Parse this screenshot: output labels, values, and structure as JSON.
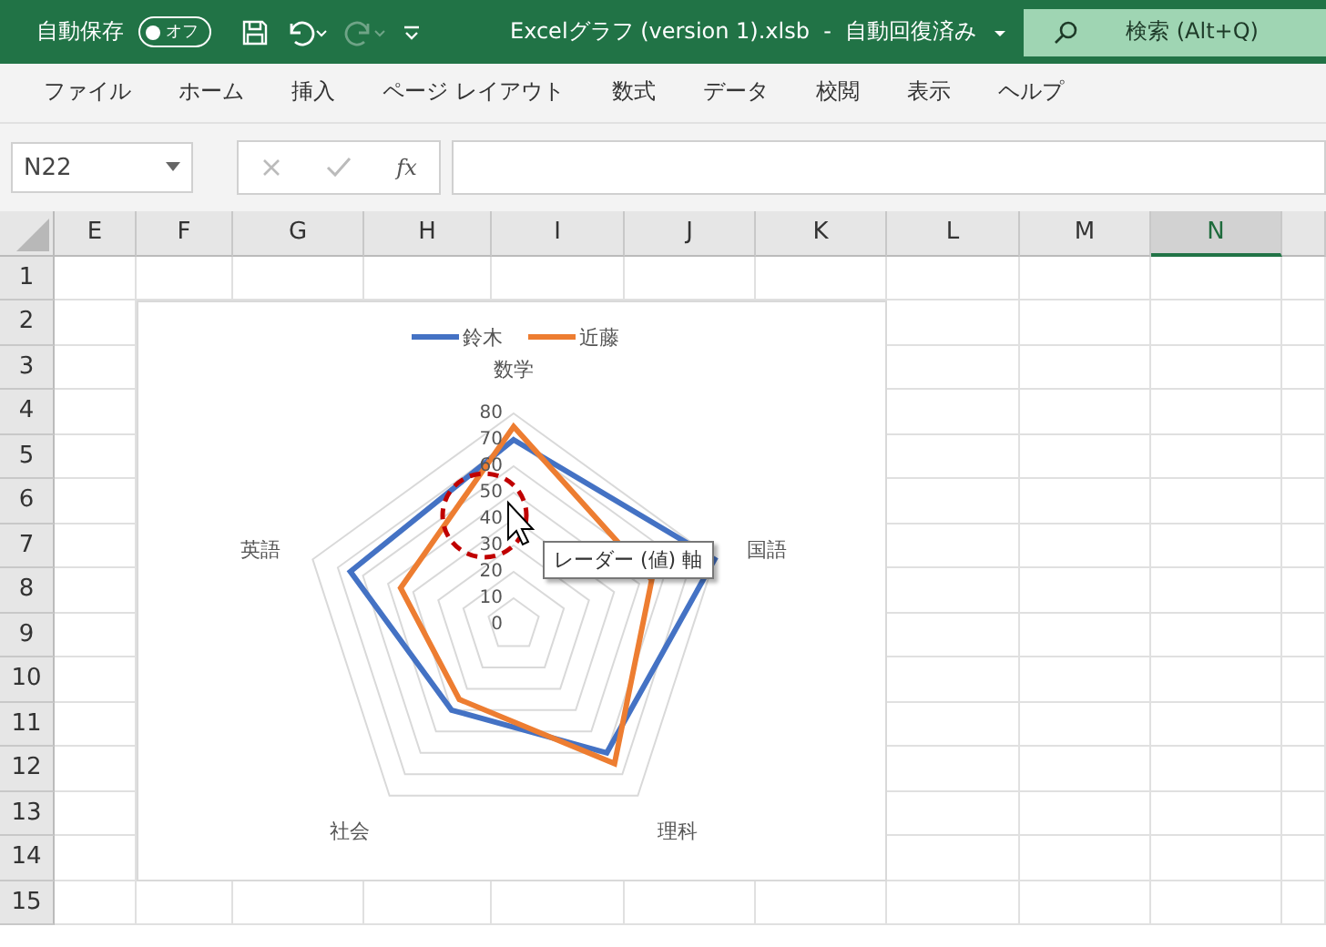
{
  "title_bar": {
    "autosave_label": "自動保存",
    "autosave_toggle": {
      "label": "オフ",
      "on": false
    },
    "redo_disabled": true,
    "title": "Excelグラフ (version 1).xlsb  -  自動回復済み",
    "search": {
      "placeholder": "検索 (Alt+Q)"
    }
  },
  "menu_tabs": [
    {
      "label": "ファイル",
      "selected": false
    },
    {
      "label": "ホーム",
      "selected": false
    },
    {
      "label": "挿入",
      "selected": false
    },
    {
      "label": "ページ レイアウト",
      "selected": false
    },
    {
      "label": "数式",
      "selected": false
    },
    {
      "label": "データ",
      "selected": false
    },
    {
      "label": "校閲",
      "selected": false
    },
    {
      "label": "表示",
      "selected": false
    },
    {
      "label": "ヘルプ",
      "selected": false
    }
  ],
  "formula_bar": {
    "name_box": "N22",
    "fx": "fx"
  },
  "columns": [
    {
      "label": "E",
      "selected": false
    },
    {
      "label": "F",
      "selected": false
    },
    {
      "label": "G",
      "selected": false
    },
    {
      "label": "H",
      "selected": false
    },
    {
      "label": "I",
      "selected": false
    },
    {
      "label": "J",
      "selected": false
    },
    {
      "label": "K",
      "selected": false
    },
    {
      "label": "L",
      "selected": false
    },
    {
      "label": "M",
      "selected": false
    },
    {
      "label": "N",
      "selected": true
    }
  ],
  "rows": [
    "1",
    "2",
    "3",
    "4",
    "5",
    "6",
    "7",
    "8",
    "9",
    "10",
    "11",
    "12",
    "13",
    "14",
    "15"
  ],
  "chart": {
    "tooltip": "レーダー (値) 軸",
    "chart_data": {
      "type": "radar",
      "legend": "top",
      "categories": [
        "数学",
        "国語",
        "理科",
        "社会",
        "英語"
      ],
      "yticks": [
        0,
        10,
        20,
        30,
        40,
        50,
        60,
        70,
        80
      ],
      "ylim": [
        0,
        80
      ],
      "series": [
        {
          "name": "鈴木",
          "color": "#4472c4",
          "values": [
            70,
            80,
            60,
            40,
            65
          ]
        },
        {
          "name": "近藤",
          "color": "#ed7d31",
          "values": [
            75,
            55,
            65,
            35,
            45
          ]
        }
      ]
    }
  }
}
